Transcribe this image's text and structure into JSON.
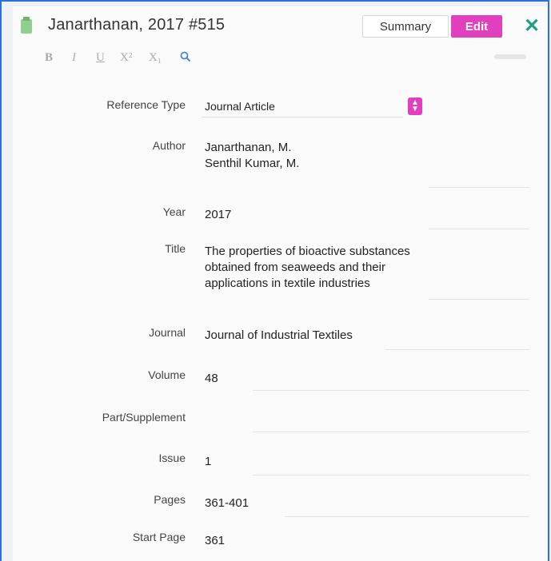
{
  "header": {
    "title": "Janarthanan, 2017 #515",
    "summary_label": "Summary",
    "edit_label": "Edit",
    "close_symbol": "✕"
  },
  "toolbar": {
    "bold": "B",
    "italic": "I",
    "underline": "U",
    "superscript": "X²",
    "subscript": "X₁",
    "search_symbol": "🔍"
  },
  "fields": {
    "reference_type": {
      "label": "Reference Type",
      "value": "Journal Article"
    },
    "author": {
      "label": "Author",
      "value_line1": "Janarthanan, M.",
      "value_line2": "Senthil Kumar, M."
    },
    "year": {
      "label": "Year",
      "value": "2017"
    },
    "title": {
      "label": "Title",
      "value_line1": "The properties of bioactive substances",
      "value_line2": "obtained from seaweeds and their",
      "value_line3": "applications in textile industries"
    },
    "journal": {
      "label": "Journal",
      "value": "Journal of Industrial Textiles"
    },
    "volume": {
      "label": "Volume",
      "value": "48"
    },
    "part_supplement": {
      "label": "Part/Supplement",
      "value": ""
    },
    "issue": {
      "label": "Issue",
      "value": "1"
    },
    "pages": {
      "label": "Pages",
      "value": "361-401"
    },
    "start_page": {
      "label": "Start Page",
      "value": "361"
    }
  },
  "colors": {
    "accent": "#e23fbf",
    "close": "#1ca08a",
    "frame": "#2f6fd6"
  }
}
